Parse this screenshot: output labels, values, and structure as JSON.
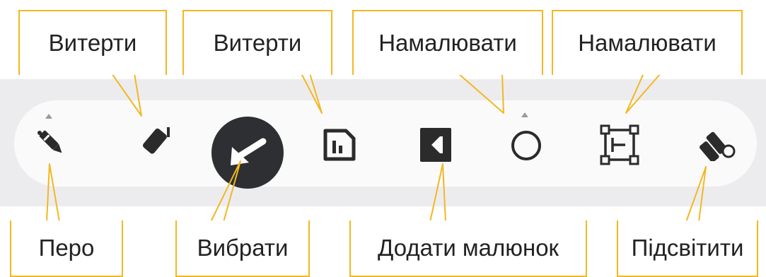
{
  "callouts": {
    "erase_1": "Витерти",
    "erase_2": "Витерти",
    "draw_1": "Намалювати",
    "draw_2": "Намалювати",
    "pen": "Перо",
    "select": "Вибрати",
    "add_picture": "Додати малюнок",
    "highlight": "Підсвітити"
  },
  "toolbar": {
    "tools": [
      "pen-icon",
      "eraser-icon",
      "select-arrow-icon",
      "chart-page-icon",
      "add-image-icon",
      "circle-shape-icon",
      "frame-shape-icon",
      "highlighter-icon"
    ],
    "selected": "select-arrow-icon"
  },
  "colors": {
    "callout_border": "#f3b820",
    "icon": "#2b2b2b",
    "toolbar_bg": "#fafafa",
    "band_bg": "#ececef"
  }
}
